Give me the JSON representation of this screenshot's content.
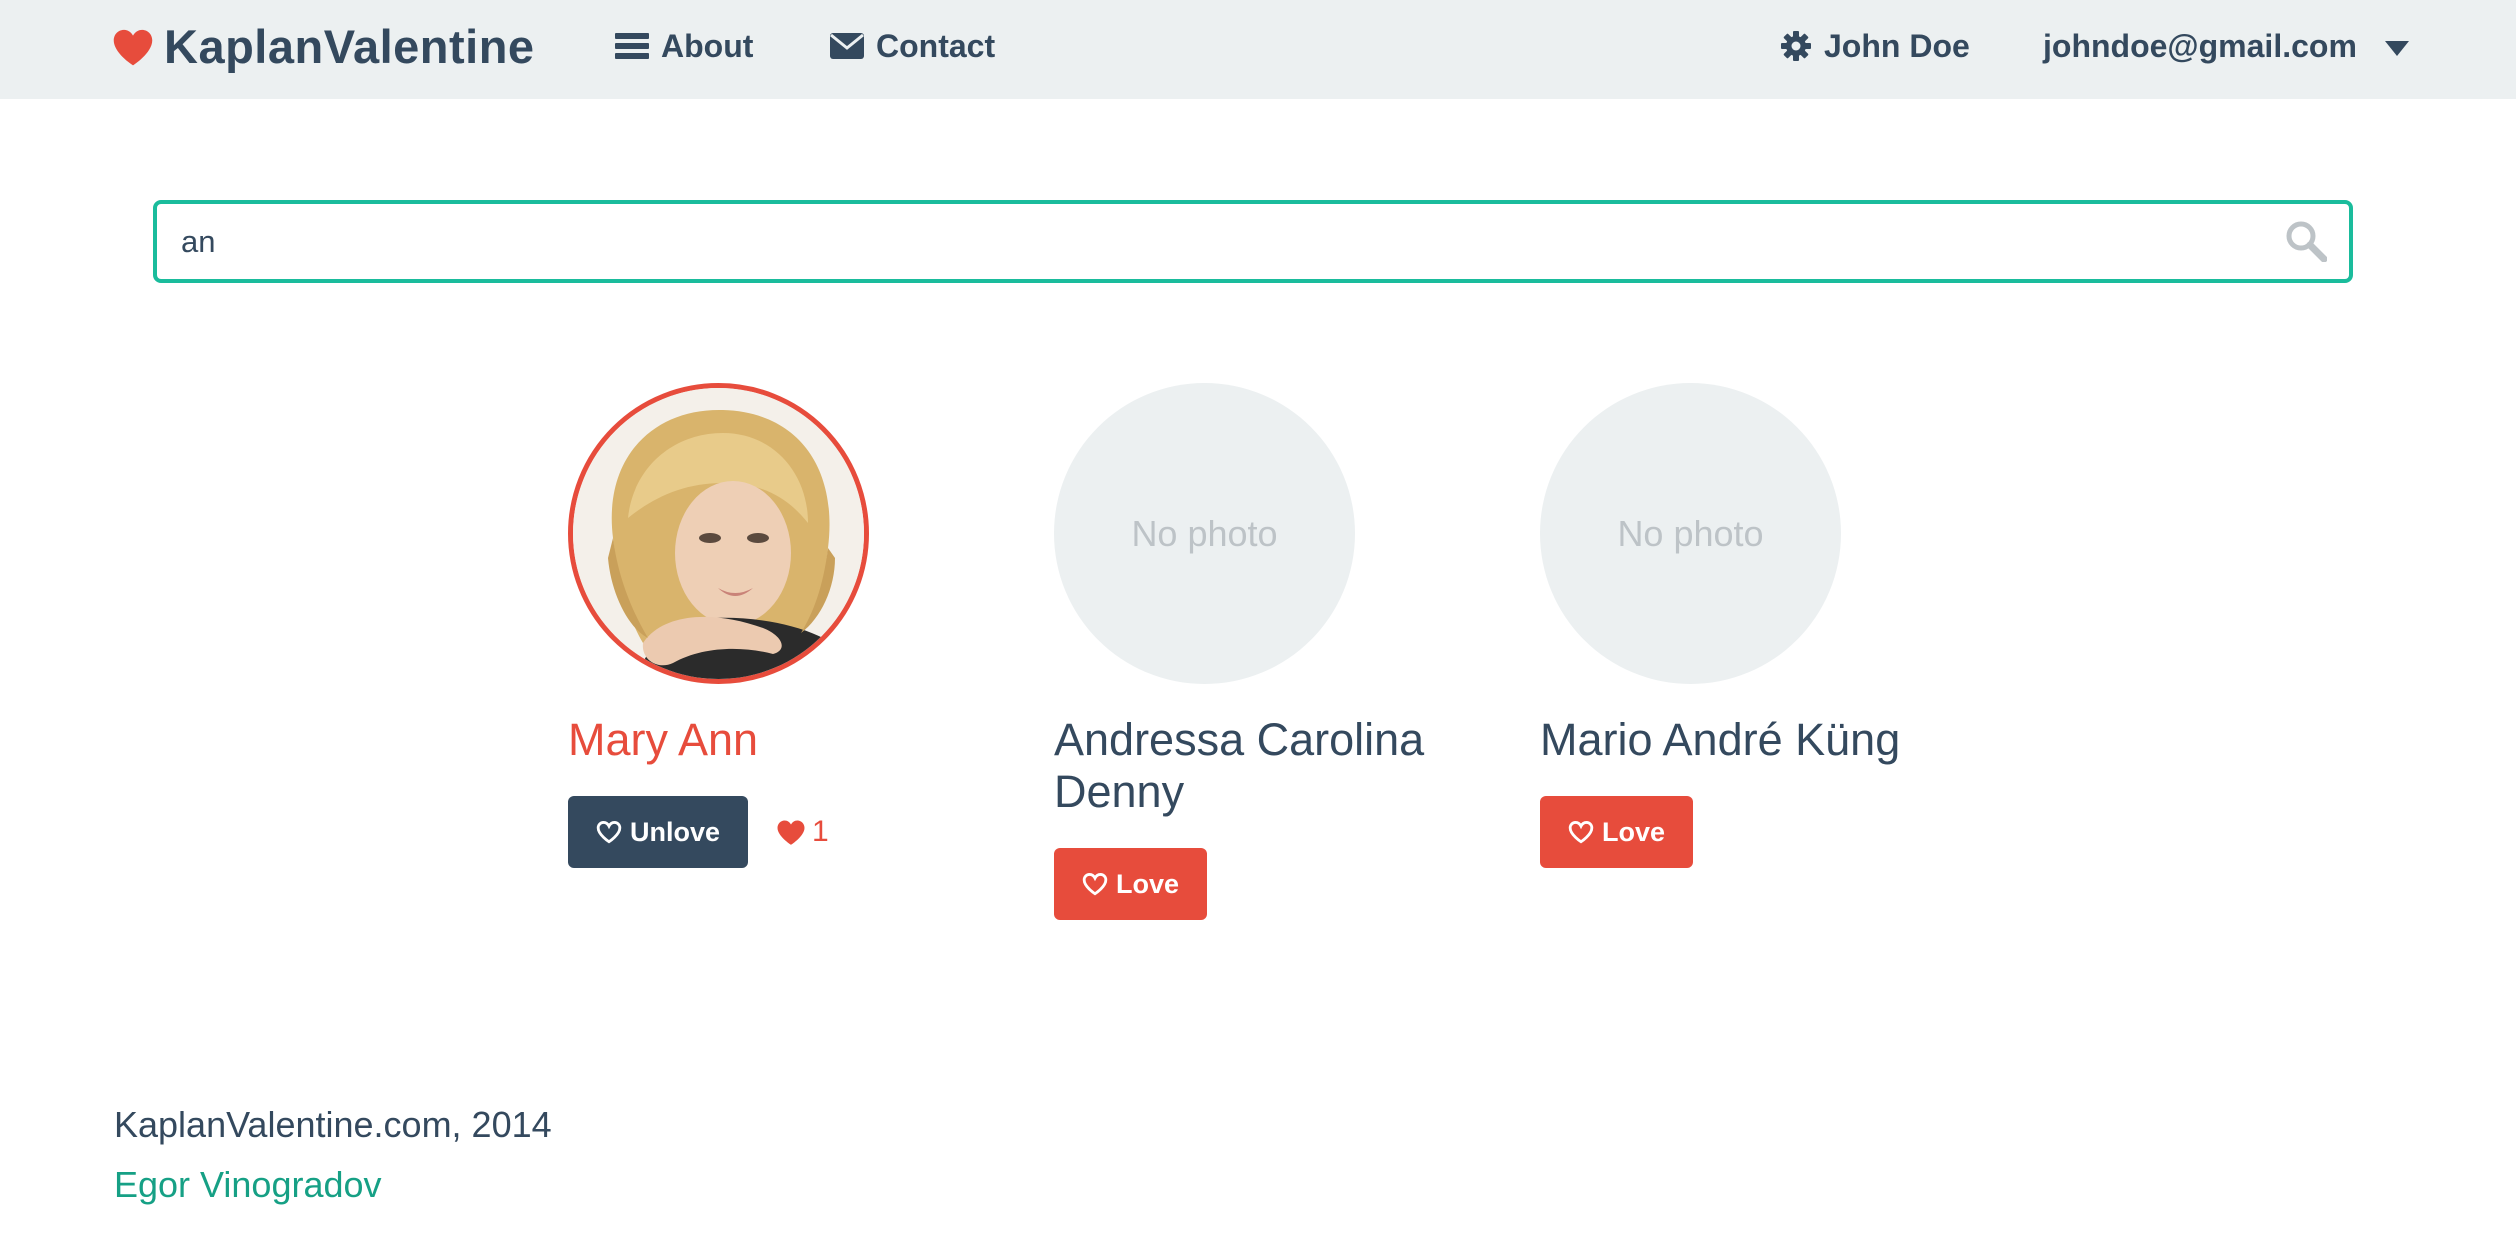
{
  "navbar": {
    "brand": "KaplanValentine",
    "about": "About",
    "contact": "Contact",
    "user_name": "John Doe",
    "user_email": "johndoe@gmail.com"
  },
  "search": {
    "value": "an"
  },
  "results": [
    {
      "name": "Mary Ann",
      "has_photo": true,
      "loved": true,
      "button_label": "Unlove",
      "love_count": "1"
    },
    {
      "name": "Andressa Carolina Denny",
      "has_photo": false,
      "no_photo_text": "No photo",
      "loved": false,
      "button_label": "Love"
    },
    {
      "name": "Mario André Küng",
      "has_photo": false,
      "no_photo_text": "No photo",
      "loved": false,
      "button_label": "Love"
    }
  ],
  "footer": {
    "copyright": "KaplanValentine.com, 2014",
    "author": "Egor Vinogradov"
  },
  "colors": {
    "accent_red": "#e74c3c",
    "navy": "#34495e",
    "teal": "#1abc9c",
    "link_green": "#16a085",
    "light_gray": "#ecf0f1"
  }
}
